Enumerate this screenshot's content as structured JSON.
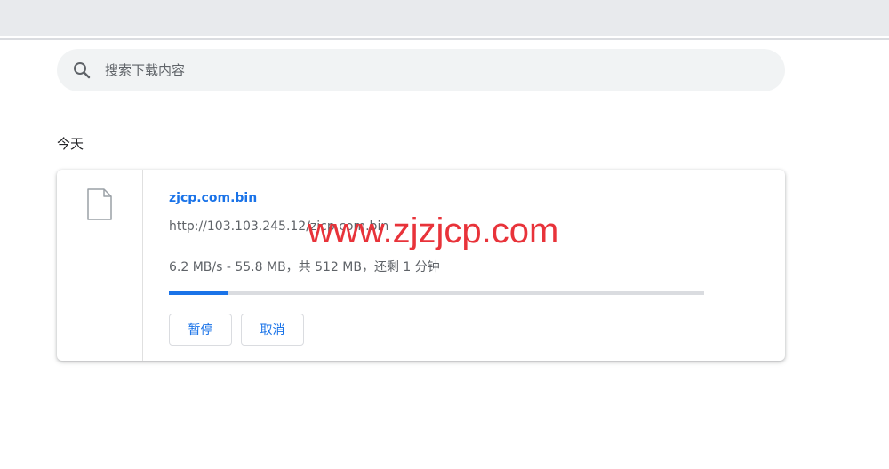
{
  "search": {
    "placeholder": "搜索下载内容"
  },
  "section": {
    "title": "今天"
  },
  "download": {
    "file_name": "zjcp.com.bin",
    "url": "http://103.103.245.12/zjcp.com.bin",
    "status": "6.2 MB/s - 55.8 MB，共 512 MB，还剩 1 分钟",
    "progress_fraction": 0.109,
    "pause_label": "暂停",
    "cancel_label": "取消"
  },
  "watermark": {
    "text": "www.zjzjcp.com"
  },
  "colors": {
    "accent": "#1a73e8",
    "watermark": "#e8333a",
    "top_bar": "#e8eaed",
    "search_bg": "#f1f3f4"
  },
  "icons": {
    "search": "search-icon",
    "file": "file-icon"
  }
}
